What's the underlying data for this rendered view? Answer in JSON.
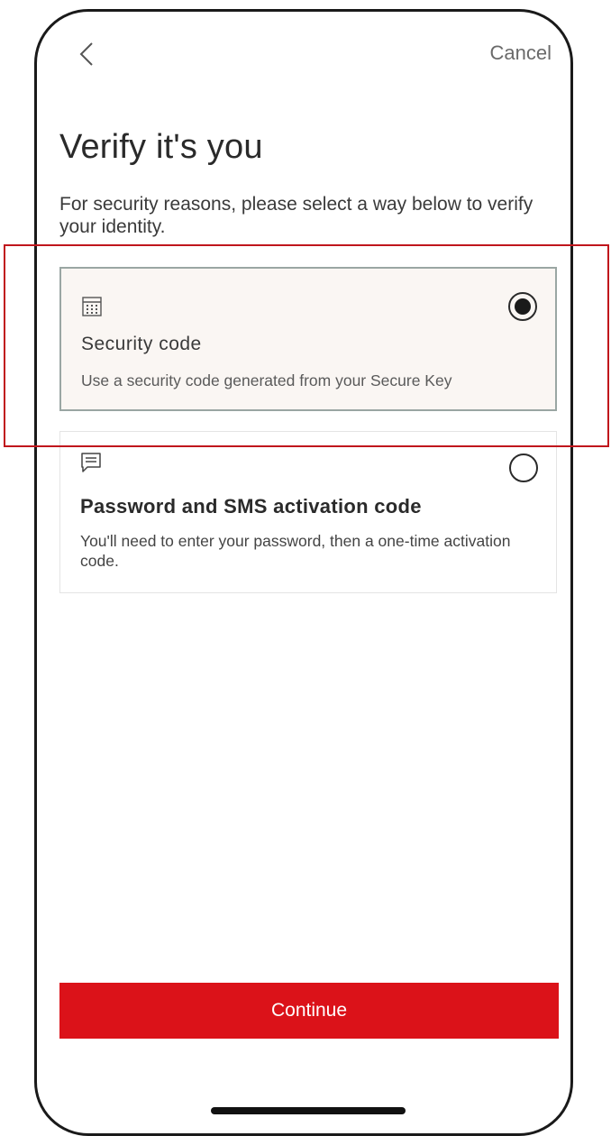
{
  "header": {
    "back_icon": "chevron-left-icon",
    "cancel_label": "Cancel"
  },
  "page": {
    "title": "Verify it's you",
    "subtitle": "For security reasons, please select a way below to verify your identity."
  },
  "options": [
    {
      "icon": "calculator-icon",
      "title": "Security code",
      "description": "Use a security code generated from your Secure Key",
      "selected": true
    },
    {
      "icon": "message-icon",
      "title": "Password and SMS activation code",
      "description": "You'll need to enter your password, then a one-time activation code.",
      "selected": false
    }
  ],
  "footer": {
    "continue_label": "Continue"
  },
  "colors": {
    "primary_button": "#db1219",
    "highlight_outline": "#c0161c",
    "selected_background": "#faf6f3"
  }
}
